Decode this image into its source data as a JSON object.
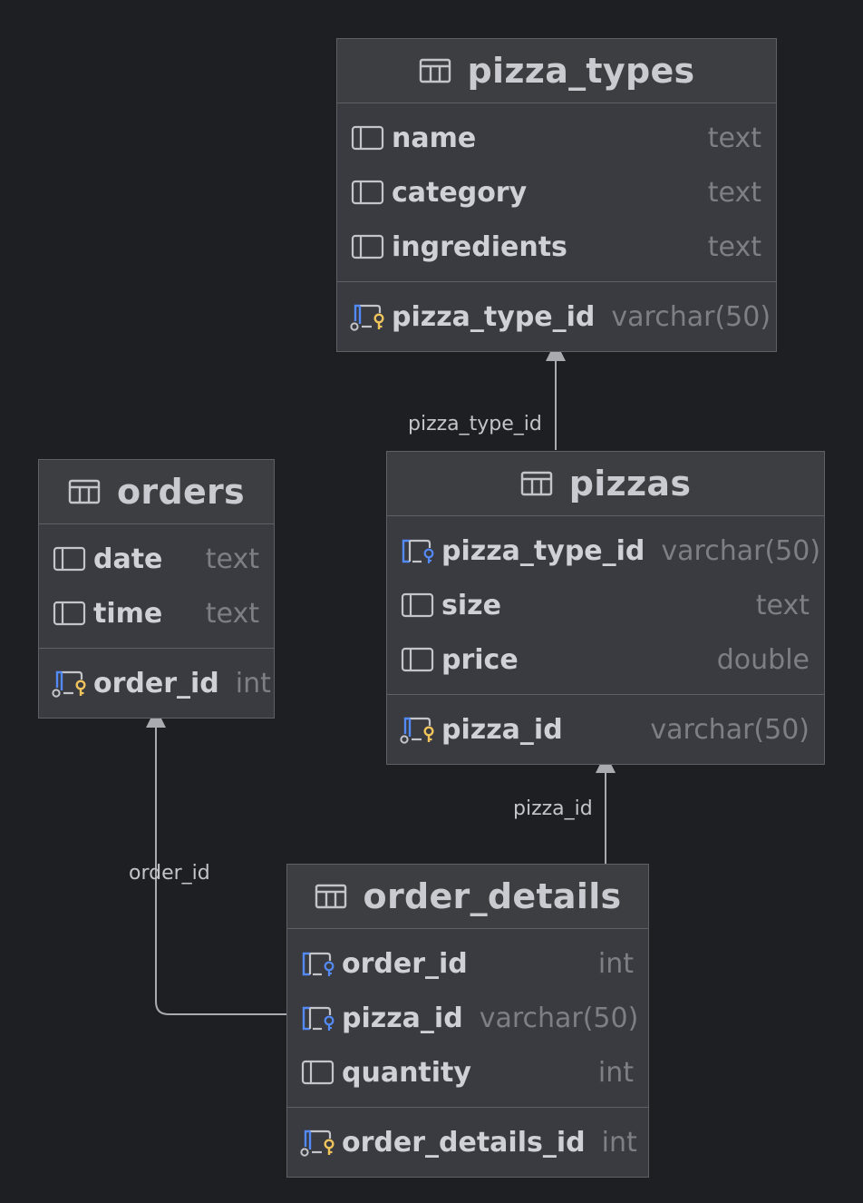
{
  "tables": {
    "pizza_types": {
      "title": "pizza_types",
      "columns": [
        {
          "name": "name",
          "type": "text",
          "icon": "column-icon"
        },
        {
          "name": "category",
          "type": "text",
          "icon": "column-icon"
        },
        {
          "name": "ingredients",
          "type": "text",
          "icon": "column-icon"
        }
      ],
      "keys": [
        {
          "name": "pizza_type_id",
          "type": "varchar(50)",
          "icon": "primary-key-icon"
        }
      ]
    },
    "orders": {
      "title": "orders",
      "columns": [
        {
          "name": "date",
          "type": "text",
          "icon": "column-icon"
        },
        {
          "name": "time",
          "type": "text",
          "icon": "column-icon"
        }
      ],
      "keys": [
        {
          "name": "order_id",
          "type": "int",
          "icon": "primary-key-icon"
        }
      ]
    },
    "pizzas": {
      "title": "pizzas",
      "columns": [
        {
          "name": "pizza_type_id",
          "type": "varchar(50)",
          "icon": "foreign-key-icon"
        },
        {
          "name": "size",
          "type": "text",
          "icon": "column-icon"
        },
        {
          "name": "price",
          "type": "double",
          "icon": "column-icon"
        }
      ],
      "keys": [
        {
          "name": "pizza_id",
          "type": "varchar(50)",
          "icon": "primary-key-icon"
        }
      ]
    },
    "order_details": {
      "title": "order_details",
      "columns": [
        {
          "name": "order_id",
          "type": "int",
          "icon": "foreign-key-icon"
        },
        {
          "name": "pizza_id",
          "type": "varchar(50)",
          "icon": "foreign-key-icon"
        },
        {
          "name": "quantity",
          "type": "int",
          "icon": "column-icon"
        }
      ],
      "keys": [
        {
          "name": "order_details_id",
          "type": "int",
          "icon": "primary-key-icon"
        }
      ]
    }
  },
  "links": [
    {
      "label": "pizza_type_id",
      "from": "pizzas",
      "to": "pizza_types"
    },
    {
      "label": "pizza_id",
      "from": "order_details",
      "to": "pizzas"
    },
    {
      "label": "order_id",
      "from": "order_details",
      "to": "orders"
    }
  ],
  "colors": {
    "background": "#1e1f22",
    "table_body": "#393b40",
    "border": "#5e6066",
    "key_blue": "#548af7",
    "key_gold": "#f2c55c",
    "connector": "#a9abb0"
  }
}
